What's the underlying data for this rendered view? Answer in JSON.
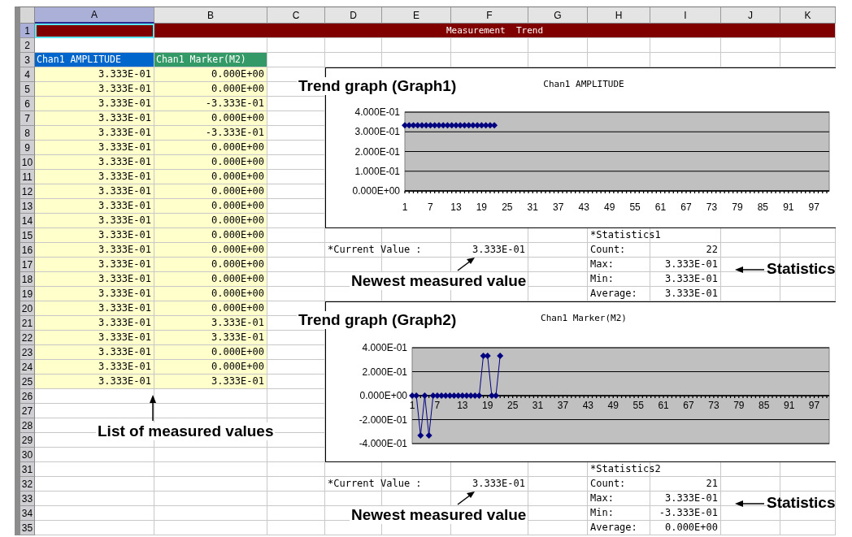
{
  "sheet": {
    "columns": [
      {
        "label": "A",
        "selected": true
      },
      {
        "label": "B",
        "selected": false
      },
      {
        "label": "C",
        "selected": false
      },
      {
        "label": "D",
        "selected": false
      },
      {
        "label": "E",
        "selected": false
      },
      {
        "label": "F",
        "selected": false
      },
      {
        "label": "G",
        "selected": false
      },
      {
        "label": "H",
        "selected": false
      },
      {
        "label": "I",
        "selected": false
      },
      {
        "label": "J",
        "selected": false
      },
      {
        "label": "K",
        "selected": false
      }
    ],
    "rows": [
      {
        "label": "1",
        "selected": true
      },
      {
        "label": "2",
        "selected": false
      },
      {
        "label": "3",
        "selected": false
      },
      {
        "label": "4",
        "selected": false
      },
      {
        "label": "5",
        "selected": false
      },
      {
        "label": "6",
        "selected": false
      },
      {
        "label": "7",
        "selected": false
      },
      {
        "label": "8",
        "selected": false
      },
      {
        "label": "9",
        "selected": false
      },
      {
        "label": "10",
        "selected": false
      },
      {
        "label": "11",
        "selected": false
      },
      {
        "label": "12",
        "selected": false
      },
      {
        "label": "13",
        "selected": false
      },
      {
        "label": "14",
        "selected": false
      },
      {
        "label": "15",
        "selected": false
      },
      {
        "label": "16",
        "selected": false
      },
      {
        "label": "17",
        "selected": false
      },
      {
        "label": "18",
        "selected": false
      },
      {
        "label": "19",
        "selected": false
      },
      {
        "label": "20",
        "selected": false
      },
      {
        "label": "21",
        "selected": false
      },
      {
        "label": "22",
        "selected": false
      },
      {
        "label": "23",
        "selected": false
      },
      {
        "label": "24",
        "selected": false
      },
      {
        "label": "25",
        "selected": false
      },
      {
        "label": "26",
        "selected": false
      },
      {
        "label": "27",
        "selected": false
      },
      {
        "label": "28",
        "selected": false
      },
      {
        "label": "29",
        "selected": false
      },
      {
        "label": "30",
        "selected": false
      },
      {
        "label": "31",
        "selected": false
      },
      {
        "label": "32",
        "selected": false
      },
      {
        "label": "33",
        "selected": false
      },
      {
        "label": "34",
        "selected": false
      },
      {
        "label": "35",
        "selected": false
      }
    ],
    "title": "Measurement  Trend",
    "list_headers": [
      {
        "text": "Chan1 AMPLITUDE",
        "color": "#0066cc"
      },
      {
        "text": "Chan1 Marker(M2)",
        "color": "#339966"
      }
    ],
    "measurements": [
      {
        "a": "3.333E-01",
        "b": "0.000E+00"
      },
      {
        "a": "3.333E-01",
        "b": "0.000E+00"
      },
      {
        "a": "3.333E-01",
        "b": "-3.333E-01"
      },
      {
        "a": "3.333E-01",
        "b": "0.000E+00"
      },
      {
        "a": "3.333E-01",
        "b": "-3.333E-01"
      },
      {
        "a": "3.333E-01",
        "b": "0.000E+00"
      },
      {
        "a": "3.333E-01",
        "b": "0.000E+00"
      },
      {
        "a": "3.333E-01",
        "b": "0.000E+00"
      },
      {
        "a": "3.333E-01",
        "b": "0.000E+00"
      },
      {
        "a": "3.333E-01",
        "b": "0.000E+00"
      },
      {
        "a": "3.333E-01",
        "b": "0.000E+00"
      },
      {
        "a": "3.333E-01",
        "b": "0.000E+00"
      },
      {
        "a": "3.333E-01",
        "b": "0.000E+00"
      },
      {
        "a": "3.333E-01",
        "b": "0.000E+00"
      },
      {
        "a": "3.333E-01",
        "b": "0.000E+00"
      },
      {
        "a": "3.333E-01",
        "b": "0.000E+00"
      },
      {
        "a": "3.333E-01",
        "b": "0.000E+00"
      },
      {
        "a": "3.333E-01",
        "b": "3.333E-01"
      },
      {
        "a": "3.333E-01",
        "b": "3.333E-01"
      },
      {
        "a": "3.333E-01",
        "b": "0.000E+00"
      },
      {
        "a": "3.333E-01",
        "b": "0.000E+00"
      },
      {
        "a": "3.333E-01",
        "b": "3.333E-01"
      }
    ],
    "list_note": "List of measured values",
    "panels": [
      {
        "graph_caption": "Trend graph (Graph1)",
        "chart_data": {
          "type": "line",
          "title": "Chan1 AMPLITUDE",
          "x": [
            1,
            2,
            3,
            4,
            5,
            6,
            7,
            8,
            9,
            10,
            11,
            12,
            13,
            14,
            15,
            16,
            17,
            18,
            19,
            20,
            21,
            22
          ],
          "xlim": [
            1,
            100
          ],
          "xticks": [
            1,
            7,
            13,
            19,
            25,
            31,
            37,
            43,
            49,
            55,
            61,
            67,
            73,
            79,
            85,
            91,
            97
          ],
          "ylim": [
            0,
            0.4
          ],
          "yticks": [
            {
              "value": 0.4,
              "label": "4.000E-01"
            },
            {
              "value": 0.3,
              "label": "3.000E-01"
            },
            {
              "value": 0.2,
              "label": "2.000E-01"
            },
            {
              "value": 0.1,
              "label": "1.000E-01"
            },
            {
              "value": 0,
              "label": "0.000E+00"
            }
          ],
          "grid": true,
          "series": [
            {
              "color": "#000080",
              "marker": "diamond",
              "values": [
                0.333,
                0.333,
                0.333,
                0.333,
                0.333,
                0.333,
                0.333,
                0.333,
                0.333,
                0.333,
                0.333,
                0.333,
                0.333,
                0.333,
                0.333,
                0.333,
                0.333,
                0.333,
                0.333,
                0.333,
                0.333,
                0.333
              ]
            }
          ]
        },
        "current_label": "*Current Value :",
        "current_value": "3.333E-01",
        "value_note": "Newest measured value",
        "stats_title": "*Statistics1",
        "stats_note": "Statistics",
        "stats": [
          {
            "label": "Count:",
            "value": "22"
          },
          {
            "label": "Max:",
            "value": "3.333E-01"
          },
          {
            "label": "Min:",
            "value": "3.333E-01"
          },
          {
            "label": "Average:",
            "value": "3.333E-01"
          }
        ]
      },
      {
        "graph_caption": "Trend graph (Graph2)",
        "chart_data": {
          "type": "line",
          "title": "Chan1 Marker(M2)",
          "x": [
            1,
            2,
            3,
            4,
            5,
            6,
            7,
            8,
            9,
            10,
            11,
            12,
            13,
            14,
            15,
            16,
            17,
            18,
            19,
            20,
            21,
            22
          ],
          "xlim": [
            1,
            100
          ],
          "xticks": [
            1,
            7,
            13,
            19,
            25,
            31,
            37,
            43,
            49,
            55,
            61,
            67,
            73,
            79,
            85,
            91,
            97
          ],
          "ylim": [
            -0.4,
            0.4
          ],
          "yticks": [
            {
              "value": 0.4,
              "label": "4.000E-01"
            },
            {
              "value": 0.2,
              "label": "2.000E-01"
            },
            {
              "value": 0,
              "label": "0.000E+00"
            },
            {
              "value": -0.2,
              "label": "-2.000E-01"
            },
            {
              "value": -0.4,
              "label": "-4.000E-01"
            }
          ],
          "grid": true,
          "series": [
            {
              "color": "#000080",
              "marker": "diamond",
              "values": [
                0,
                0,
                -0.333,
                0,
                -0.333,
                0,
                0,
                0,
                0,
                0,
                0,
                0,
                0,
                0,
                0,
                0,
                0,
                0.333,
                0.333,
                0,
                0,
                0.333
              ]
            }
          ]
        },
        "current_label": "*Current Value :",
        "current_value": "3.333E-01",
        "value_note": "Newest measured value",
        "stats_title": "*Statistics2",
        "stats_note": "Statistics",
        "stats": [
          {
            "label": "Count:",
            "value": "21"
          },
          {
            "label": "Max:",
            "value": "3.333E-01"
          },
          {
            "label": "Min:",
            "value": "-3.333E-01"
          },
          {
            "label": "Average:",
            "value": "0.000E+00"
          }
        ]
      }
    ]
  }
}
